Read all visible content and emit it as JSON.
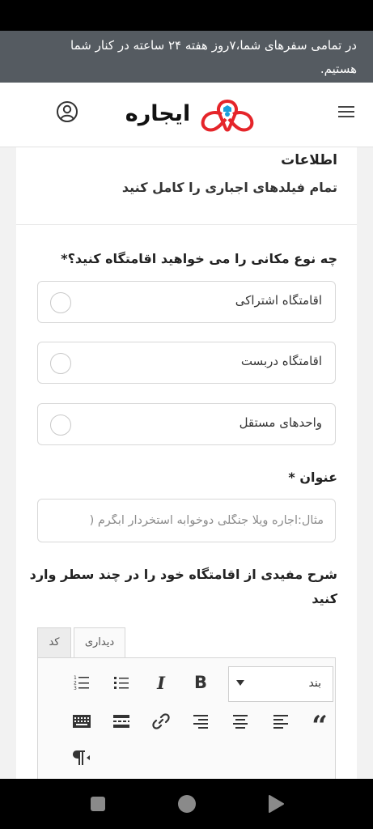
{
  "banner": {
    "line1": "در تمامی سفرهای شما،۷روز هفته ۲۴ ساعته در کنار شما",
    "line2": "هستیم."
  },
  "header": {
    "logo_text": "ایجاره",
    "icons": {
      "user": "user-icon",
      "menu": "hamburger-menu-icon",
      "logo": "ijare-logo-mark"
    },
    "colors": {
      "brand_red": "#e5252a",
      "brand_blue": "#1aa0db"
    }
  },
  "form": {
    "section_title": "اطلاعات",
    "section_subtitle": "تمام فیلدهای اجباری را کامل کنید",
    "place_type": {
      "question": "چه نوع مکانی را می خواهید اقامتگاه کنید؟*",
      "options": [
        {
          "label": "اقامتگاه اشتراکی",
          "selected": false
        },
        {
          "label": "اقامتگاه دربست",
          "selected": false
        },
        {
          "label": "واحدهای مستقل",
          "selected": false
        }
      ]
    },
    "title_field": {
      "label": "عنوان *",
      "placeholder": "مثال:اجاره ویلا جنگلی دوخوابه استخردار آبگرم (",
      "value": ""
    },
    "description": {
      "label_line1": "شرح مفیدی از اقامتگاه خود را در چند سطر وارد",
      "label_line2": "کنید"
    },
    "editor": {
      "tabs": {
        "visual": "دیداری",
        "code": "کد"
      },
      "active_tab": "visual",
      "format_select": "بند",
      "tools": [
        "bold",
        "italic",
        "bulleted-list",
        "numbered-list",
        "blockquote",
        "align-left",
        "align-center",
        "align-right",
        "link",
        "read-more",
        "toolbar-toggle",
        "paragraph-rtl"
      ],
      "bold_glyph": "B",
      "italic_glyph": "I",
      "quote_glyph": "“"
    }
  }
}
